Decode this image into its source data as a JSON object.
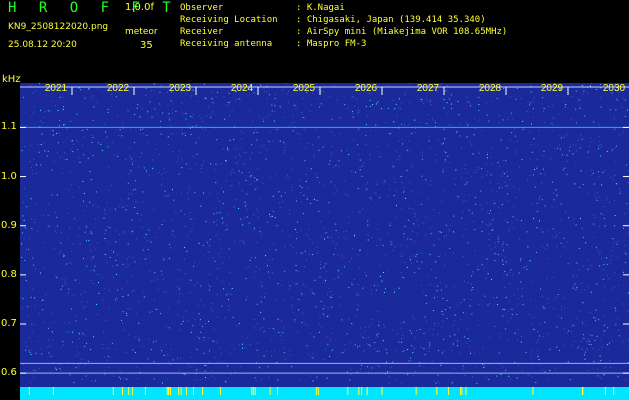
{
  "header": {
    "app_name": "H R O F F T",
    "app_version": "1.0.0f",
    "file_name": "KN9_2508122020.png",
    "date_time": "25.08.12 20:20",
    "mode_label": "meteor",
    "mode_value": "35",
    "meta": [
      {
        "key": "Observer",
        "value": ": K.Nagai"
      },
      {
        "key": "Receiving Location",
        "value": ": Chigasaki, Japan (139.414 35.340)"
      },
      {
        "key": "Receiver",
        "value": ": AirSpy mini (Miakejima VOR 108.65MHz)"
      },
      {
        "key": "Receiving antenna",
        "value": ": Maspro FM-3"
      }
    ]
  },
  "colors": {
    "background": "#000000",
    "plot_background": "#1a2a9a",
    "noise_speck": "#4ff0ff",
    "signal_band": "#00e5ff",
    "axis_text": "#ffff33",
    "title_green": "#22ff22"
  },
  "chart_data": {
    "type": "heatmap",
    "ylabel": "kHz",
    "ylim": [
      0.58,
      1.17
    ],
    "ytick_labels": [
      "1.1",
      "1.0",
      "0.9",
      "0.8",
      "0.7",
      "0.6"
    ],
    "ytick_values": [
      1.1,
      1.0,
      0.9,
      0.8,
      0.7,
      0.6
    ],
    "xtick_labels": [
      "2021",
      "2022",
      "2023",
      "2024",
      "2025",
      "2026",
      "2027",
      "2028",
      "2029",
      "2030"
    ],
    "reference_lines_khz": [
      1.1,
      0.6,
      0.62
    ],
    "bottom_band": "saturated"
  }
}
